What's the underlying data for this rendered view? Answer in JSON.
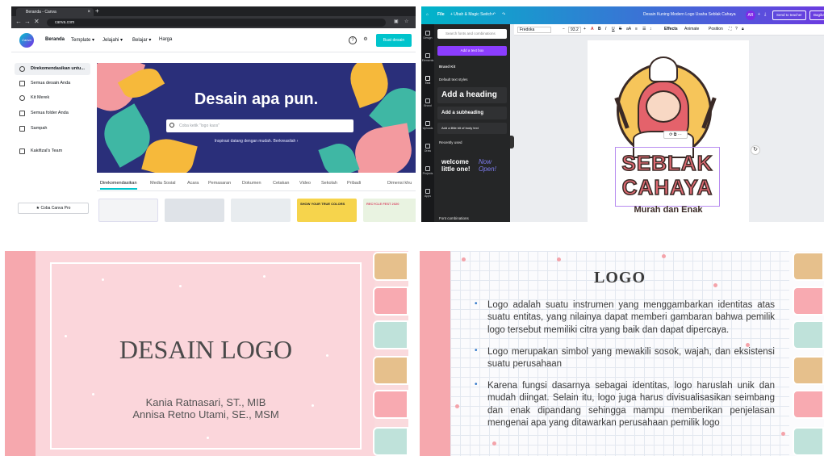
{
  "panel1": {
    "browser": {
      "tab_title": "Beranda - Canva",
      "tab_close": "×",
      "new_tab": "+",
      "url": "canva.com"
    },
    "canva": {
      "logo": "Canva",
      "menu": [
        "Beranda",
        "Template ▾",
        "Jelajahi ▾",
        "Belajar ▾",
        "Harga"
      ],
      "create_button": "Buat desain",
      "help_icon": "?",
      "settings_icon": "⚙",
      "sidebar": [
        {
          "label": "Direkomendasikan untu...",
          "active": true
        },
        {
          "label": "Semua desain Anda",
          "active": false
        },
        {
          "label": "Kit Merek",
          "active": false
        },
        {
          "label": "Semua folder Anda",
          "active": false
        },
        {
          "label": "Sampah",
          "active": false
        },
        {
          "label": "Kakifizal's Team",
          "active": false
        }
      ],
      "pro_button": "★ Coba Canva Pro",
      "hero_title": "Desain apa pun.",
      "search_placeholder": "Coba ketik \"logo kaos\"",
      "hero_subtitle": "Inspirasi datang dengan mudah. Berkreasilah ›",
      "categories": [
        "Direkomendasikan",
        "Media Sosial",
        "Acara",
        "Pemasaran",
        "Dokumen",
        "Cetakan",
        "Video",
        "Sekolah",
        "Pribadi",
        "Dimensi khu"
      ],
      "thumbnail_texts": [
        "SHOW YOUR TRUE COLORS",
        "RECYCLE FEST 2020"
      ],
      "colors": {
        "accent": "#00c4cc",
        "hero": "#2a2f7a"
      }
    }
  },
  "panel2": {
    "topbar": {
      "home": "⌂",
      "file": "File",
      "resize": "+ Ubah & Magic Switch",
      "undo": "↶",
      "redo": "↷",
      "doc_title": "Desain Kuning Modern Logo Usaha Seblak Cahaya",
      "avatar": "AR",
      "plus": "+",
      "share_icon": "⤓",
      "teacher": "Send to teacher",
      "share": "Bagikan"
    },
    "rail": [
      "Design",
      "Elements",
      "Text",
      "Brand",
      "Uploads",
      "Draw",
      "Projects",
      "Apps"
    ],
    "text_panel": {
      "search_placeholder": "Search fonts and combinations",
      "add_text": "Add a text box",
      "brand_kit": "Brand Kit",
      "default_styles": "Default text styles",
      "heading": "Add a heading",
      "subheading": "Add a subheading",
      "body": "Add a little bit of body text",
      "recently_used": "Recently used",
      "sample1": "welcome little one!",
      "sample2": "Now Open!",
      "font_combinations": "Font combinations"
    },
    "toolbar": {
      "font": "Fredoka",
      "size": "93.2",
      "bold": "B",
      "italic": "I",
      "underline": "U",
      "strike": "S",
      "case": "aA",
      "effects": "Effects",
      "animate": "Animate",
      "position": "Position"
    },
    "logo": {
      "line1": "SEBLAK",
      "line2": "CAHAYA",
      "tagline": "Murah dan Enak"
    },
    "colors": {
      "gradient_start": "#00b5c9",
      "gradient_end": "#6b3be0",
      "logo_text": "#e06a73",
      "logo_circle": "#f6c55a"
    }
  },
  "panel3": {
    "title": "DESAIN LOGO",
    "authors": [
      "Kania Ratnasari, ST., MIB",
      "Annisa Retno Utami, SE., MSM"
    ],
    "tab_colors": [
      "#e6c08c",
      "#f8aab1",
      "#bfe2da",
      "#e6c08c",
      "#f8aab1",
      "#bfe2da",
      "#e6c08c"
    ]
  },
  "panel4": {
    "title": "LOGO",
    "bullets": [
      "Logo adalah suatu instrumen yang menggambarkan identitas atas suatu entitas, yang nilainya dapat memberi gambaran bahwa pemilik logo tersebut memiliki citra yang baik dan dapat dipercaya.",
      "Logo merupakan simbol yang mewakili sosok, wajah, dan eksistensi suatu perusahaan",
      "Karena fungsi dasarnya sebagai identitas, logo haruslah unik dan mudah diingat. Selain itu, logo juga harus divisualisasikan seimbang dan enak dipandang sehingga mampu memberikan penjelasan mengenai apa yang ditawarkan perusahaan pemilik logo"
    ],
    "bullet_char": "•",
    "tab_colors": [
      "#e6c08c",
      "#f8aab1",
      "#bfe2da",
      "#e6c08c",
      "#f8aab1",
      "#bfe2da",
      "#e6c08c"
    ]
  }
}
